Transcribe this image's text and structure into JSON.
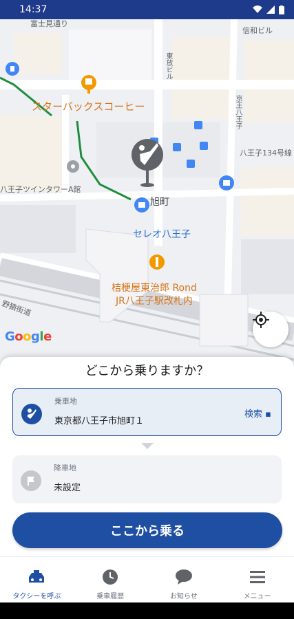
{
  "status_bar": {
    "time": "14:37"
  },
  "map": {
    "labels": {
      "fujimi": "富士見通り",
      "shinwa": "信和ビル",
      "higashi": "東放ビル",
      "kyoto": "京王八王子",
      "hachioji134": "八王子134号線",
      "starbucks": "スターバックスコーヒー",
      "twintower": "八王子ツインタワーA館",
      "asahicho": "旭町",
      "celeo": "セレオ八王子",
      "restaurant1": "桔梗屋東治郎 Rond",
      "restaurant2": "JR八王子駅改札内",
      "nogawa": "野猿街道"
    },
    "google_logo": "Google",
    "colors": {
      "pin": "#5f6368",
      "poi_blue": "#4285f4",
      "poi_orange": "#f29900",
      "route": "#1e8e3e"
    }
  },
  "sheet": {
    "title": "どこから乗りますか？",
    "pickup": {
      "label": "乗車地",
      "value": "東京都八王子市旭町１",
      "search": "検索 ▪"
    },
    "dropoff": {
      "label": "降車地",
      "value": "未設定"
    },
    "cta": "ここから乗る"
  },
  "nav": {
    "items": [
      {
        "label": "タクシーを呼ぶ",
        "icon": "taxi-icon"
      },
      {
        "label": "乗車履歴",
        "icon": "clock-icon"
      },
      {
        "label": "お知らせ",
        "icon": "chat-bubble-icon"
      },
      {
        "label": "メニュー",
        "icon": "menu-icon"
      }
    ]
  },
  "colors": {
    "primary": "#1e4fa3",
    "status_bar": "#1e3a8a"
  }
}
